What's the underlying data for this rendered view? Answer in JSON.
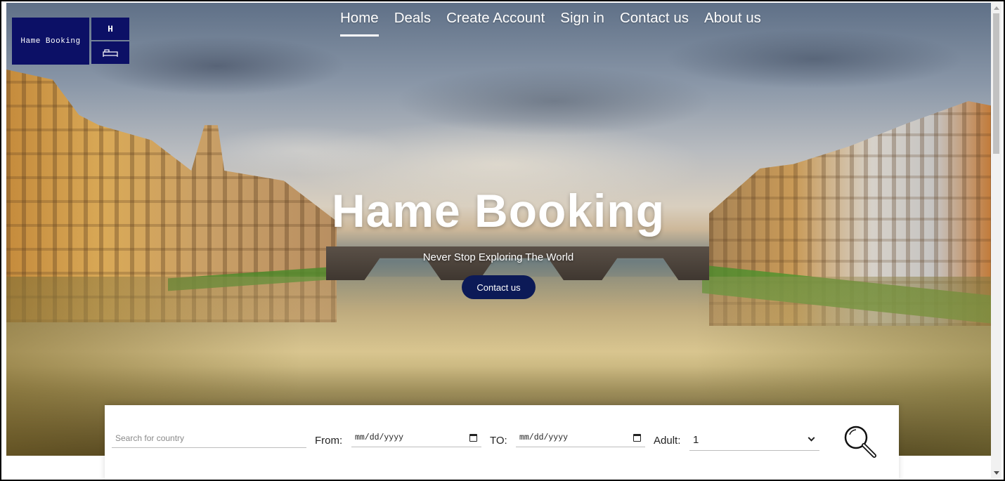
{
  "logo": {
    "text": "Hame Booking",
    "letter": "H",
    "icon": "bed-icon"
  },
  "nav": {
    "items": [
      {
        "label": "Home",
        "active": true
      },
      {
        "label": "Deals",
        "active": false
      },
      {
        "label": "Create Account",
        "active": false
      },
      {
        "label": "Sign in",
        "active": false
      },
      {
        "label": "Contact us",
        "active": false
      },
      {
        "label": "About us",
        "active": false
      }
    ]
  },
  "hero": {
    "title": "Hame Booking",
    "subtitle": "Never Stop Exploring The World",
    "cta_label": "Contact us"
  },
  "search": {
    "country_placeholder": "Search for country",
    "from_label": "From:",
    "from_value": "mm/dd/yyyy",
    "to_label": "TO:",
    "to_value": "mm/dd/yyyy",
    "adult_label": "Adult:",
    "adult_value": "1",
    "search_icon": "search-icon"
  },
  "colors": {
    "brand_navy": "#0c1066",
    "cta_navy": "#0c1a57"
  }
}
